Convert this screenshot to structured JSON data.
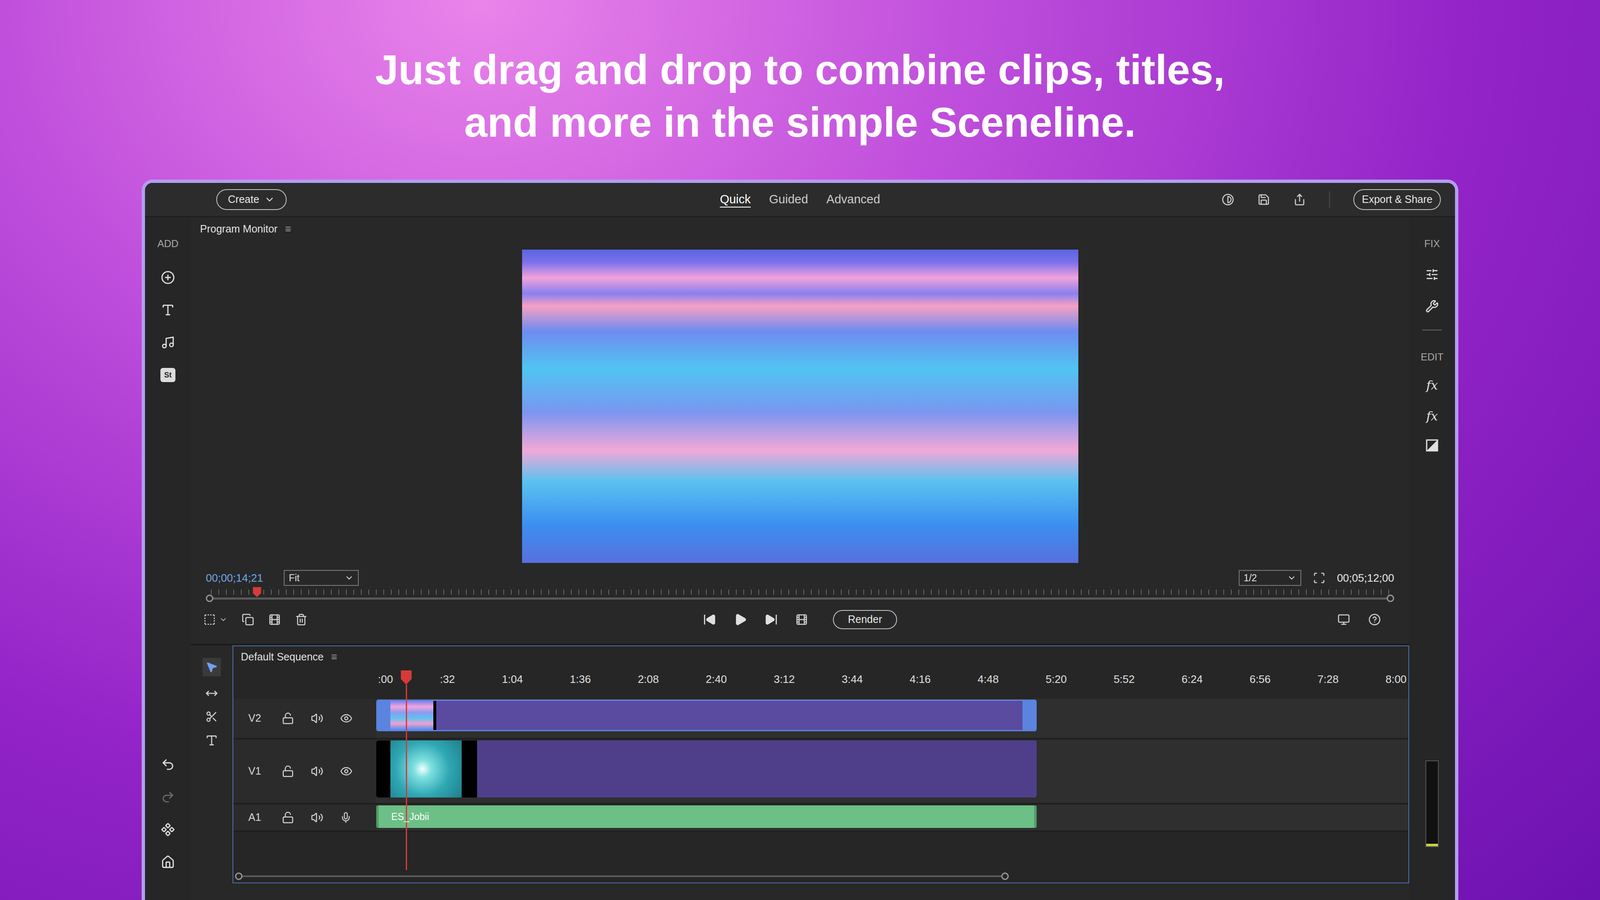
{
  "headline": [
    "Just drag and drop to combine clips, titles,",
    "and more in the simple Sceneline."
  ],
  "top_bar": {
    "create_button": "Create",
    "modes": [
      {
        "label": "Quick",
        "selected": true
      },
      {
        "label": "Guided",
        "selected": false
      },
      {
        "label": "Advanced",
        "selected": false
      }
    ],
    "export_button": "Export & Share"
  },
  "left_toolbar": {
    "label": "ADD",
    "badge": "St"
  },
  "right_toolbar": {
    "fix_label": "FIX",
    "edit_label": "EDIT",
    "effects": [
      "fx",
      "fx"
    ]
  },
  "program_monitor": {
    "title": "Program Monitor",
    "menu": "≡",
    "current_time": "00;00;14;21",
    "zoom": "Fit",
    "resolution": "1/2",
    "duration": "00;05;12;00",
    "playhead": 0.043,
    "render_button": "Render"
  },
  "timeline": {
    "title": "Default Sequence",
    "menu": "≡",
    "ruler": [
      ":00",
      ":32",
      "1:04",
      "1:36",
      "2:08",
      "2:40",
      "3:12",
      "3:44",
      "4:16",
      "4:48",
      "5:20",
      "5:52",
      "6:24",
      "6:56",
      "7:28",
      "8:00"
    ],
    "playhead": 0.029,
    "tracks": [
      {
        "name": "V2",
        "kind": "overlay",
        "level": 0.64,
        "clip_label": ""
      },
      {
        "name": "V1",
        "kind": "video",
        "level": 0.64,
        "clip_label": ""
      },
      {
        "name": "A1",
        "kind": "audio",
        "level": 0.64,
        "clip_label": "ES_Jobii"
      }
    ]
  }
}
